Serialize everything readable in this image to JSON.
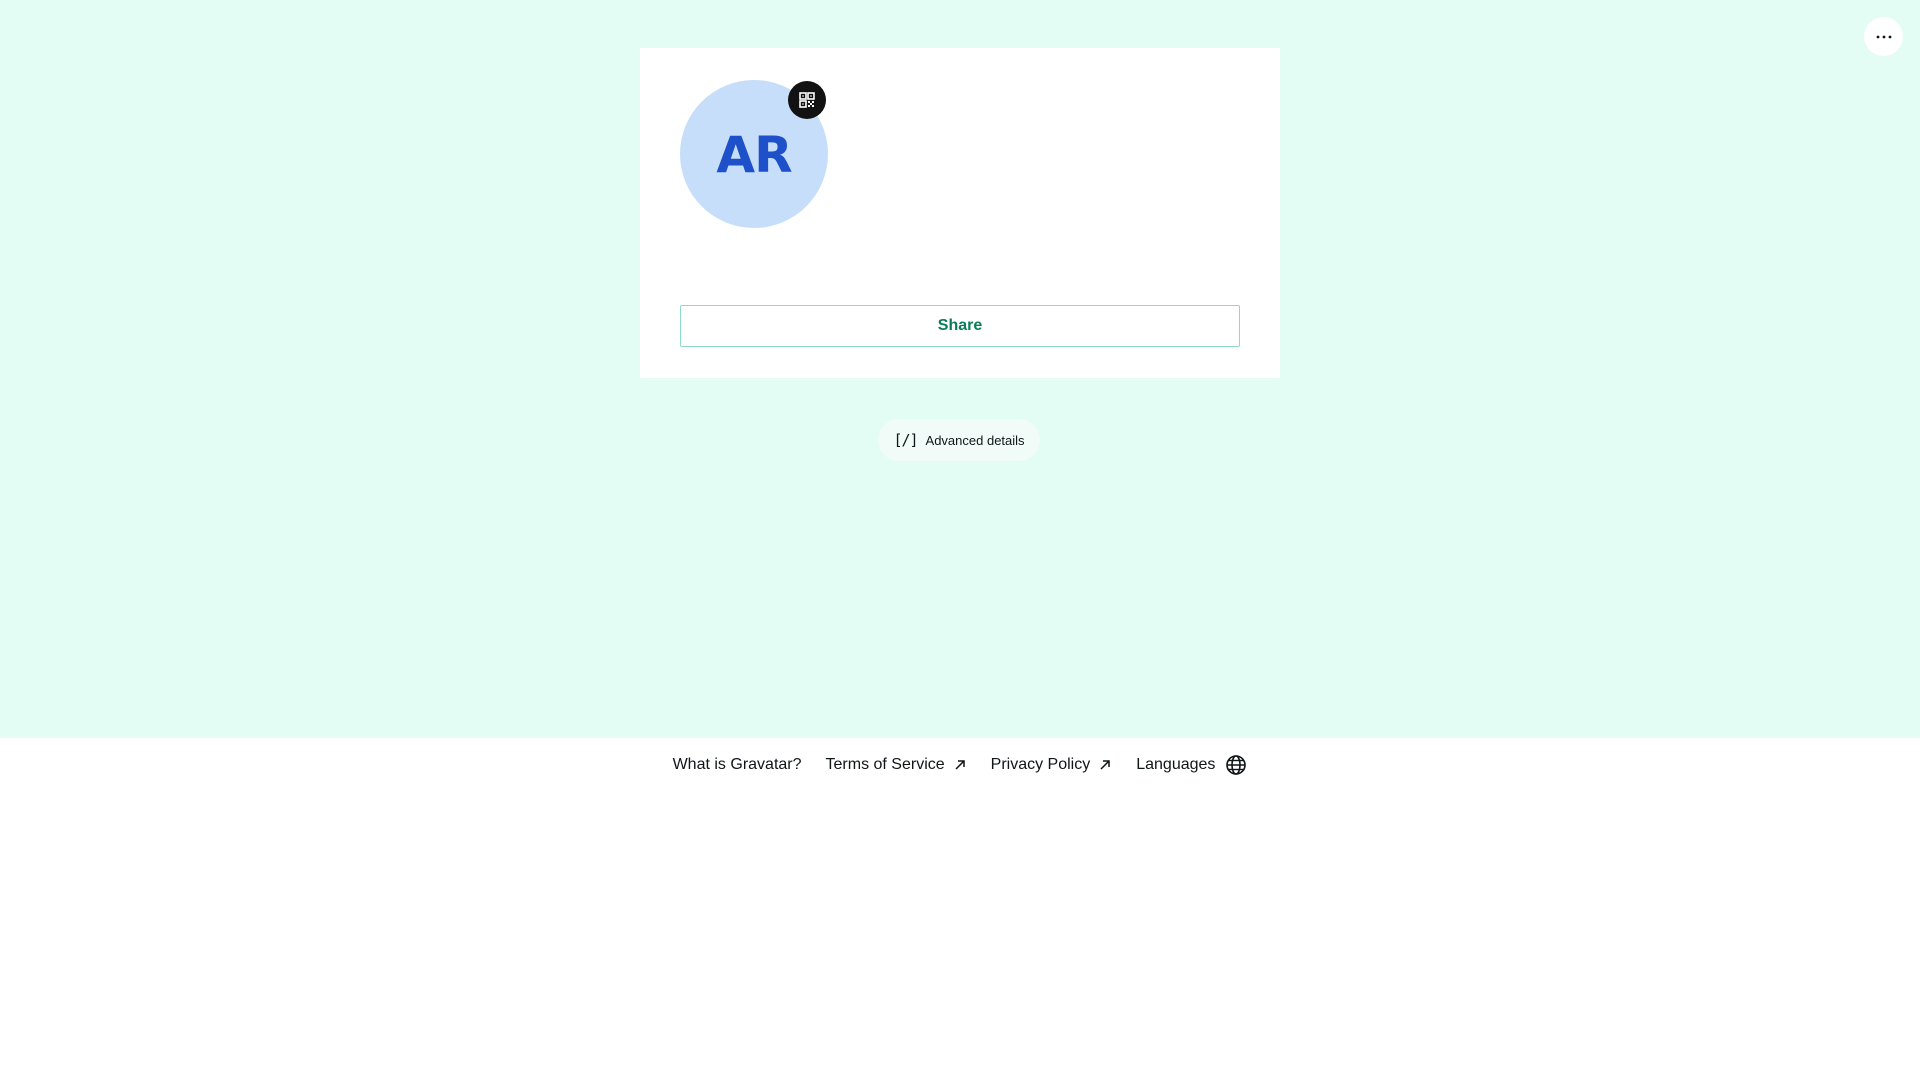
{
  "profile": {
    "initials": "AR",
    "avatar_color": "#c6def9",
    "initials_color": "#1e50c9",
    "qr_icon": "qr-code-icon"
  },
  "actions": {
    "share_label": "Share",
    "advanced_label": "Advanced details",
    "advanced_icon_text": "[/]"
  },
  "top_menu": {
    "icon": "more-horizontal-icon"
  },
  "footer": {
    "links": [
      {
        "label": "What is Gravatar?",
        "icon": ""
      },
      {
        "label": "Terms of Service",
        "icon": "external-arrow-icon"
      },
      {
        "label": "Privacy Policy",
        "icon": "external-arrow-icon"
      },
      {
        "label": "Languages",
        "icon": "globe-icon"
      }
    ]
  },
  "colors": {
    "background": "#e3fdf5",
    "accent": "#0a7d5a",
    "share_border": "#8fd9c7"
  }
}
